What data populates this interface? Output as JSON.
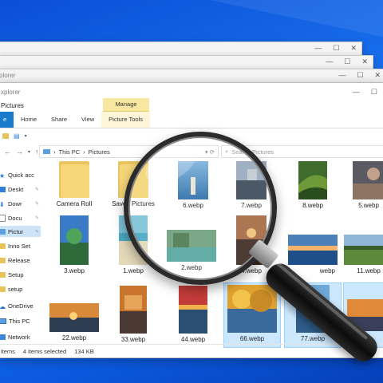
{
  "back_windows": [
    {
      "title": ""
    },
    {
      "title": ""
    },
    {
      "title": "plorer"
    }
  ],
  "window": {
    "title": "xplorer",
    "location_title": "Pictures",
    "manage_label": "Manage",
    "tabs": [
      "e",
      "Home",
      "Share",
      "View",
      "Picture Tools"
    ],
    "breadcrumb": [
      "This PC",
      "Pictures"
    ],
    "search_placeholder": "Search Pictures",
    "controls": {
      "minimize": "—",
      "maximize": "☐",
      "close": "✕"
    }
  },
  "sidebar": {
    "items": [
      {
        "label": "Quick acc",
        "icon": "star-icon"
      },
      {
        "label": "Deskt",
        "icon": "desktop-icon"
      },
      {
        "label": "Dowr",
        "icon": "download-icon"
      },
      {
        "label": "Docu",
        "icon": "documents-icon"
      },
      {
        "label": "Pictur",
        "icon": "pictures-icon"
      },
      {
        "label": "Inno Set",
        "icon": "folder-icon"
      },
      {
        "label": "Release",
        "icon": "folder-icon"
      },
      {
        "label": "Setup",
        "icon": "folder-icon"
      },
      {
        "label": "setup",
        "icon": "folder-icon"
      },
      {
        "label": "OneDrive",
        "icon": "cloud-icon"
      },
      {
        "label": "This PC",
        "icon": "pc-icon"
      },
      {
        "label": "Network",
        "icon": "network-icon"
      }
    ]
  },
  "files": [
    {
      "name": "Camera Roll",
      "type": "folder"
    },
    {
      "name": "Saved Pictures",
      "type": "folder"
    },
    {
      "name": "6.webp",
      "type": "image"
    },
    {
      "name": "7.webp",
      "type": "image"
    },
    {
      "name": "8.webp",
      "type": "image"
    },
    {
      "name": "5.webp",
      "type": "image"
    },
    {
      "name": "3.webp",
      "type": "image"
    },
    {
      "name": "1.webp",
      "type": "image"
    },
    {
      "name": "2.webp",
      "type": "image"
    },
    {
      "name": "4.webp",
      "type": "image"
    },
    {
      "name": "webp",
      "type": "image"
    },
    {
      "name": "11.webp",
      "type": "image"
    },
    {
      "name": "22.webp",
      "type": "image"
    },
    {
      "name": "33.webp",
      "type": "image"
    },
    {
      "name": "44.webp",
      "type": "image"
    },
    {
      "name": "66.webp",
      "type": "image"
    },
    {
      "name": "77.webp",
      "type": "image"
    },
    {
      "name": "",
      "type": "image"
    }
  ],
  "status": {
    "items": "items",
    "selected": "4 items selected",
    "size": "134 KB"
  }
}
